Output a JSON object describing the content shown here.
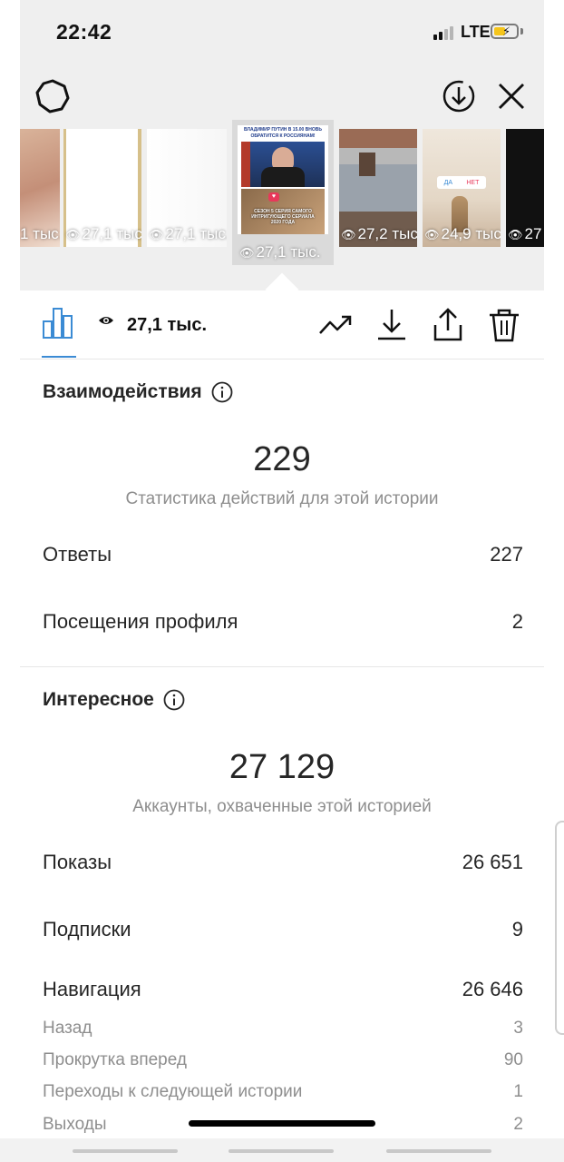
{
  "status_bar": {
    "time": "22:42",
    "network": "LTE"
  },
  "stories": [
    {
      "views": "1 тыс."
    },
    {
      "views": "27,1 тыс."
    },
    {
      "views": "27,1 тыс."
    },
    {
      "views": "27,1 тыс.",
      "selected": true,
      "headline": "ВЛАДИМИР ПУТИН В 15.00 ВНОВЬ ОБРАТИТСЯ К РОССИЯНАМ!",
      "caption": "СЕЗОН 5 СЕРИЯ САМОГО ИНТРИГУЮЩЕГО СЕРИАЛА 2020 ГОДА"
    },
    {
      "views": "27,2 тыс."
    },
    {
      "views": "24,9 тыс.",
      "poll_yes": "ДА",
      "poll_no": "НЕТ"
    },
    {
      "views": "27"
    }
  ],
  "toolbar": {
    "views_count": "27,1 тыс.",
    "icons": [
      "bar-chart-icon",
      "eye-icon",
      "trending-icon",
      "download-icon",
      "share-icon",
      "trash-icon"
    ]
  },
  "interactions": {
    "title": "Взаимодействия",
    "total": "229",
    "subtitle": "Статистика действий для этой истории",
    "rows": [
      {
        "label": "Ответы",
        "value": "227"
      },
      {
        "label": "Посещения профиля",
        "value": "2"
      }
    ]
  },
  "discovery": {
    "title": "Интересное",
    "total": "27 129",
    "subtitle": "Аккаунты, охваченные этой историей",
    "rows": [
      {
        "label": "Показы",
        "value": "26 651"
      },
      {
        "label": "Подписки",
        "value": "9"
      },
      {
        "label": "Навигация",
        "value": "26 646"
      }
    ],
    "navigation_rows": [
      {
        "label": "Назад",
        "value": "3"
      },
      {
        "label": "Прокрутка вперед",
        "value": "90"
      },
      {
        "label": "Переходы к следующей истории",
        "value": "1"
      },
      {
        "label": "Выходы",
        "value": "2"
      }
    ]
  },
  "colors": {
    "accent": "#3b8bd4",
    "muted": "#8e8e8e",
    "text": "#262626"
  }
}
